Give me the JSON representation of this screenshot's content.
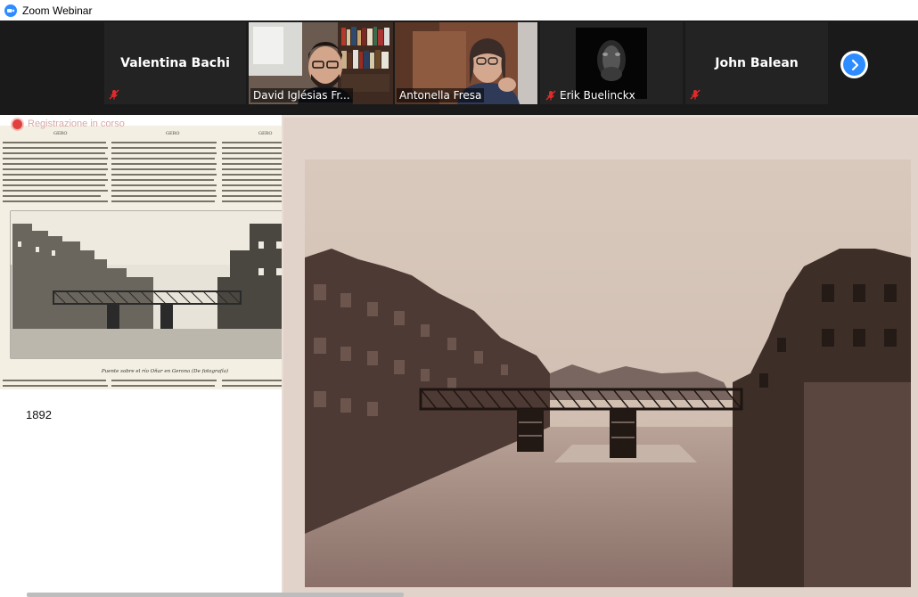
{
  "window": {
    "title": "Zoom Webinar"
  },
  "participants": [
    {
      "name": "Valentina Bachi",
      "video": false,
      "muted": true
    },
    {
      "name": "David Iglésias Fr...",
      "video": true,
      "muted": false,
      "active_speaker": true
    },
    {
      "name": "Antonella Fresa",
      "video": true,
      "muted": false
    },
    {
      "name": "Erik Buelinckx",
      "video": true,
      "muted": true
    },
    {
      "name": "John Balean",
      "video": false,
      "muted": true
    }
  ],
  "share": {
    "recording_label": "Registrazione in corso",
    "year_caption": "1892",
    "clipping_caption": "Puente sobre el río Oñar en Gerona (De fotografía)",
    "clipping_headers": [
      "GERO",
      "GERO",
      "GERO"
    ]
  },
  "colors": {
    "zoom_blue": "#2D8CFF",
    "active_speaker_border": "#9fe25a",
    "record_red": "#e0413f",
    "mute_red": "#e02b2b"
  }
}
